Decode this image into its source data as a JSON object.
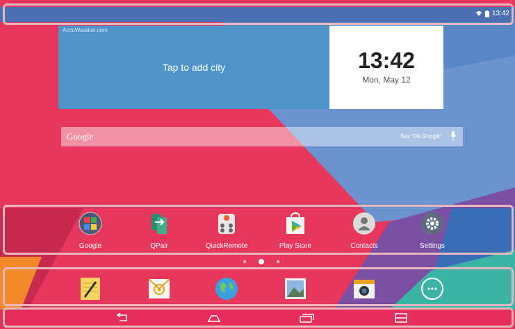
{
  "status_bar": {
    "time": "13:42",
    "wifi_icon": "wifi-icon",
    "battery_icon": "battery-icon"
  },
  "weather_widget": {
    "source": "AccuWeather.com",
    "prompt": "Tap to add city"
  },
  "clock_widget": {
    "time": "13:42",
    "date": "Mon, May 12"
  },
  "search_bar": {
    "logo": "Google",
    "hint": "Say \"Ok Google\"",
    "mic_icon": "microphone-icon"
  },
  "apps": [
    {
      "label": "Google",
      "icon": "google-folder-icon"
    },
    {
      "label": "QPair",
      "icon": "qpair-icon"
    },
    {
      "label": "QuickRemote",
      "icon": "quickremote-icon"
    },
    {
      "label": "Play Store",
      "icon": "play-store-icon"
    },
    {
      "label": "Contacts",
      "icon": "contacts-icon"
    },
    {
      "label": "Settings",
      "icon": "settings-icon"
    }
  ],
  "page_indicator": {
    "pages": 3,
    "current": 2
  },
  "dock": [
    {
      "icon": "notes-icon"
    },
    {
      "icon": "email-icon"
    },
    {
      "icon": "browser-icon"
    },
    {
      "icon": "gallery-icon"
    },
    {
      "icon": "camera-icon"
    },
    {
      "icon": "app-drawer-icon"
    }
  ],
  "nav_bar": [
    {
      "icon": "back-icon"
    },
    {
      "icon": "home-icon"
    },
    {
      "icon": "recent-apps-icon"
    },
    {
      "icon": "dual-window-icon"
    }
  ],
  "colors": {
    "wallpaper_pink": "#ea3a5e",
    "wallpaper_blue": "#5b86c8",
    "status_blue": "#4d6fb3",
    "weather_blue": "#4e93c9",
    "frame": "#e8b7bd"
  }
}
